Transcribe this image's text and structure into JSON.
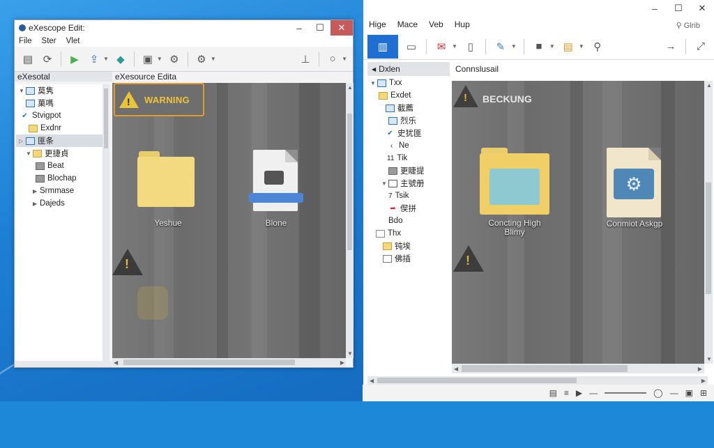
{
  "left_window": {
    "title": "eXescope Edit:",
    "menu": [
      "File",
      "Ster",
      "Vlet"
    ],
    "tree_header": "eXesotal",
    "content_header": "eXesource Edita",
    "tree": [
      {
        "label": "莫隽",
        "icon": "folder-blue-icon"
      },
      {
        "label": "菓嗎",
        "icon": "blue-box-icon"
      },
      {
        "label": "Stvigpot",
        "icon": "check-icon"
      },
      {
        "label": "Exdnr",
        "icon": "folder-icon"
      },
      {
        "label": "匪条",
        "icon": "blue-box-icon"
      },
      {
        "label": "更捷貞",
        "icon": "folder-icon"
      },
      {
        "label": "Beat",
        "icon": "gray-box-icon"
      },
      {
        "label": "Blochap",
        "icon": "gray-box-icon"
      },
      {
        "label": "Srmmase",
        "icon": "none"
      },
      {
        "label": "Dajeds",
        "icon": "none"
      }
    ],
    "warning_label": "WARNING",
    "folder_label": "Yeshue",
    "file_label": "Blone"
  },
  "right_window": {
    "menu": [
      "Hige",
      "Mace",
      "Veb",
      "Hup"
    ],
    "search_placeholder": "Glrib",
    "tree_header": "Dxlen",
    "content_header": "Connslusail",
    "tree": [
      {
        "label": "Txx",
        "icon": "blue-box-icon"
      },
      {
        "label": "Exdet",
        "icon": "folder-icon"
      },
      {
        "label": "截薦",
        "icon": "blue-box-icon"
      },
      {
        "label": "烈乐",
        "icon": "blue-box-icon"
      },
      {
        "label": "史犹匪",
        "icon": "check-icon"
      },
      {
        "label": "Ne",
        "icon": "chevron-left-icon"
      },
      {
        "label": "Tik",
        "icon": "number-11-icon"
      },
      {
        "label": "更睫提",
        "icon": "gray-box-icon"
      },
      {
        "label": "主號册",
        "icon": "box-icon"
      },
      {
        "label": "Tsik",
        "icon": "number-7-icon"
      },
      {
        "label": "偰拼",
        "icon": "red-arrow-icon"
      },
      {
        "label": "Bdo",
        "icon": "none"
      },
      {
        "label": "Thx",
        "icon": "folder-icon"
      },
      {
        "label": "钝埃",
        "icon": "folder-icon"
      },
      {
        "label": "佛插",
        "icon": "doc-icon"
      }
    ],
    "warning_label": "BECKUNG",
    "folder_label": "Concting High Blimy",
    "file_label": "Conmiot Askgp"
  }
}
